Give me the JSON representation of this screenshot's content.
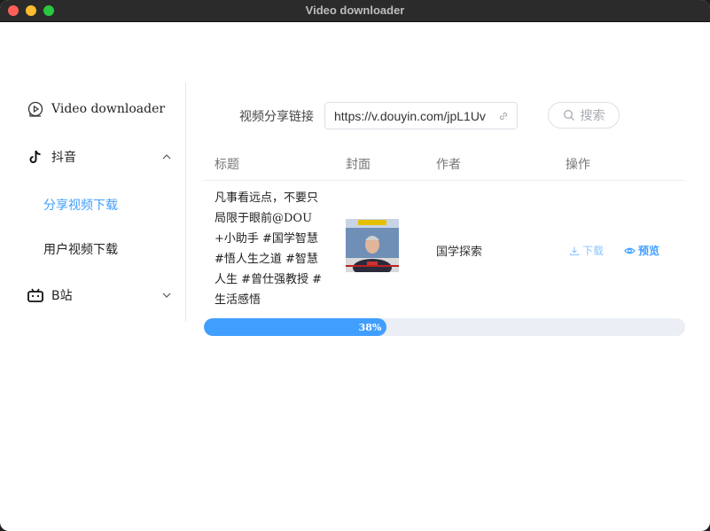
{
  "window": {
    "title": "Video downloader"
  },
  "sidebar": {
    "brand": "Video downloader",
    "douyin": {
      "label": "抖音",
      "icon": "tiktok-icon",
      "expanded": true,
      "items": [
        {
          "label": "分享视频下载",
          "active": true
        },
        {
          "label": "用户视频下载",
          "active": false
        }
      ]
    },
    "bilibili": {
      "label": "B站",
      "icon": "bilibili-icon",
      "expanded": false
    }
  },
  "search": {
    "label": "视频分享链接",
    "url_value": "https://v.douyin.com/jpL1Uv",
    "button_label": "搜索"
  },
  "table": {
    "columns": [
      "标题",
      "封面",
      "作者",
      "操作"
    ],
    "rows": [
      {
        "title": "凡事看远点，不要只局限于眼前@DOU+小助手 #国学智慧 #悟人生之道 #智慧人生 #曾仕强教授 #生活感悟",
        "author": "国学探索",
        "download_label": "下载",
        "preview_label": "预览"
      }
    ]
  },
  "progress": {
    "percent": 38,
    "label": "38%"
  },
  "colors": {
    "accent": "#409eff",
    "track": "#ebeef5"
  }
}
